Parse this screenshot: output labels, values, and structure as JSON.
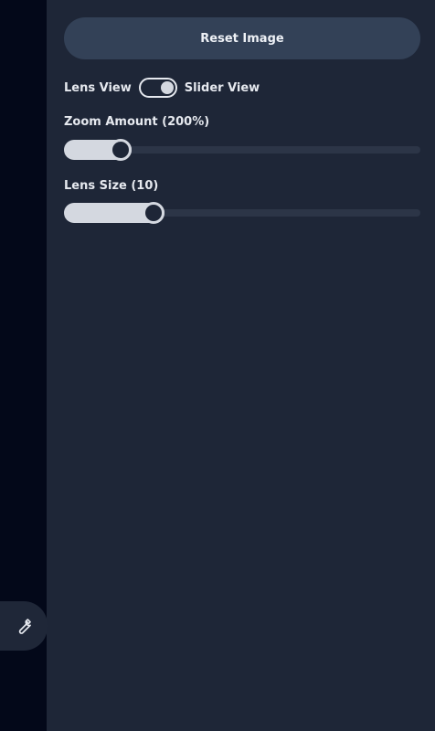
{
  "panel": {
    "reset_label": "Reset Image",
    "view_toggle": {
      "left_label": "Lens View",
      "right_label": "Slider View",
      "selected": "Slider View"
    },
    "zoom": {
      "label": "Zoom Amount (200%)",
      "value_fraction": 0.16
    },
    "lens_size": {
      "label": "Lens Size (10)",
      "value_fraction": 0.25
    }
  },
  "rail": {
    "tool_icon": "wrench-icon"
  },
  "colors": {
    "background": "#1e2637",
    "rail": "#030819",
    "button": "#334157",
    "track": "#2c3547",
    "fill": "#d4d8e0"
  }
}
